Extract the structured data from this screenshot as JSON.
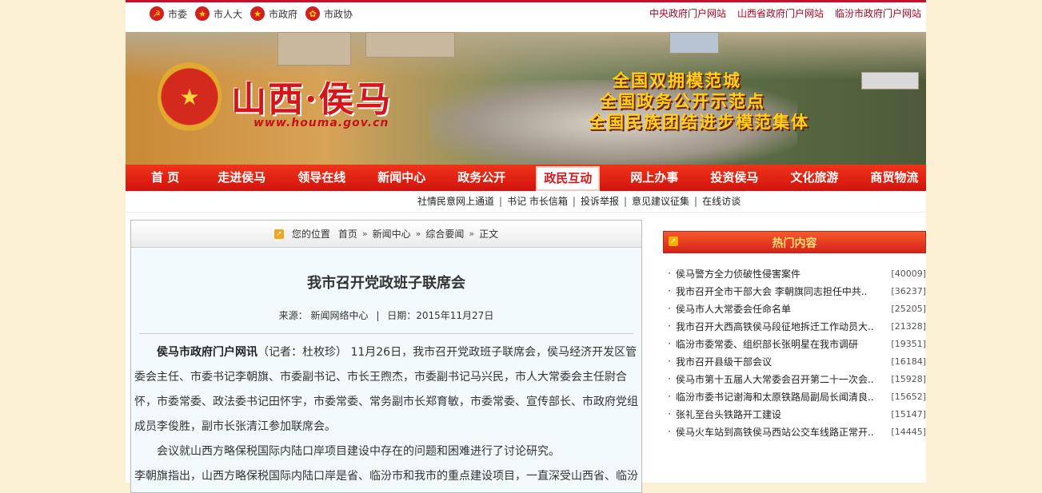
{
  "topbar": {
    "links": [
      {
        "icon": "party-emblem-icon",
        "glyph": "☭",
        "label": "市委"
      },
      {
        "icon": "national-emblem-icon",
        "glyph": "★",
        "label": "市人大"
      },
      {
        "icon": "national-emblem-icon",
        "glyph": "★",
        "label": "市政府"
      },
      {
        "icon": "cppcc-emblem-icon",
        "glyph": "✿",
        "label": "市政协"
      }
    ],
    "external": [
      "中央政府门户网站",
      "山西省政府门户网站",
      "临汾市政府门户网站"
    ]
  },
  "banner": {
    "title": "山西·侯马",
    "url": "www.houma.gov.cn",
    "slogans": [
      "全国双拥模范城",
      "全国政务公开示范点",
      "全国民族团结进步模范集体"
    ]
  },
  "nav": {
    "items": [
      "首 页",
      "走进侯马",
      "领导在线",
      "新闻中心",
      "政务公开",
      "政民互动",
      "网上办事",
      "投资侯马",
      "文化旅游",
      "商贸物流"
    ],
    "active": "政民互动",
    "sub_items": [
      "社情民意网上通道",
      "书记 市长信箱",
      "投诉举报",
      "意见建议征集",
      "在线访谈"
    ]
  },
  "breadcrumb": {
    "label": "您的位置",
    "items": [
      "首页",
      "新闻中心",
      "综合要闻",
      "正文"
    ]
  },
  "article": {
    "title": "我市召开党政班子联席会",
    "source_label": "来源：",
    "source": "新闻网络中心",
    "date_label": "日期：",
    "date": "2015年11月27日",
    "lead": "侯马市政府门户网讯",
    "p1": "（记者：杜枚珍） 11月26日，我市召开党政班子联席会，侯马经济开发区管委会主任、市委书记李朝旗、市委副书记、市长王煦杰，市委副书记马兴民，市人大常委会主任尉合怀，市委常委、政法委书记田怀宇，市委常委、常务副市长郑育敏，市委常委、宣传部长、市政府党组成员李俊胜，副市长张清江参加联席会。",
    "p2": "会议就山西方略保税国际内陆口岸项目建设中存在的问题和困难进行了讨论研究。",
    "p3": "李朝旗指出，山西方略保税国际内陆口岸是省、临汾市和我市的重点建设项目，一直深受山西省、临汾"
  },
  "hot": {
    "title": "热门内容",
    "items": [
      {
        "text": "侯马警方全力侦破性侵害案件",
        "count": "[40009]"
      },
      {
        "text": "我市召开全市干部大会 李朝旗同志担任中共..",
        "count": "[36237]"
      },
      {
        "text": "侯马市人大常委会任命名单",
        "count": "[25205]"
      },
      {
        "text": "我市召开大西高铁侯马段征地拆迁工作动员大..",
        "count": "[21328]"
      },
      {
        "text": "临汾市委常委、组织部长张明星在我市调研",
        "count": "[19351]"
      },
      {
        "text": "我市召开县级干部会议",
        "count": "[16184]"
      },
      {
        "text": "侯马市第十五届人大常委会召开第二十一次会..",
        "count": "[15928]"
      },
      {
        "text": "临汾市委书记谢海和太原铁路局副局长闻清良..",
        "count": "[15652]"
      },
      {
        "text": "张礼至台头铁路开工建设",
        "count": "[15147]"
      },
      {
        "text": "侯马火车站到高铁侯马西站公交车线路正常开..",
        "count": "[14445]"
      }
    ]
  },
  "colors": {
    "brand_red": "#d2120d",
    "accent_gold": "#ffd21a",
    "page_bg": "#fbf0d4"
  }
}
